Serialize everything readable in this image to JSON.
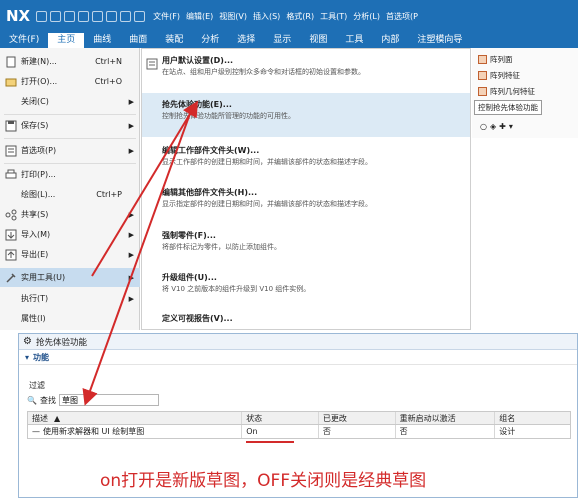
{
  "titlebar": {
    "logo": "NX",
    "menus": [
      "文件(F)",
      "编辑(E)",
      "视图(V)",
      "插入(S)",
      "格式(R)",
      "工具(T)",
      "分析(L)",
      "首选项(P"
    ]
  },
  "ribbon_tabs": [
    "文件(F)",
    "主页",
    "曲线",
    "曲面",
    "装配",
    "分析",
    "选择",
    "显示",
    "视图",
    "工具",
    "内部",
    "注塑模向导"
  ],
  "file_menu": [
    {
      "label": "新建(N)...",
      "shortcut": "Ctrl+N",
      "submenu": false
    },
    {
      "label": "打开(O)...",
      "shortcut": "Ctrl+O",
      "submenu": false
    },
    {
      "label": "关闭(C)",
      "shortcut": "",
      "submenu": true
    },
    {
      "label": "保存(S)",
      "shortcut": "",
      "submenu": true
    },
    {
      "label": "首选项(P)",
      "shortcut": "",
      "submenu": true
    },
    {
      "label": "打印(P)...",
      "shortcut": "",
      "submenu": false
    },
    {
      "label": "绘图(L)...",
      "shortcut": "Ctrl+P",
      "submenu": false
    },
    {
      "label": "共享(S)",
      "shortcut": "",
      "submenu": true
    },
    {
      "label": "导入(M)",
      "shortcut": "",
      "submenu": true
    },
    {
      "label": "导出(E)",
      "shortcut": "",
      "submenu": true
    },
    {
      "label": "实用工具(U)",
      "shortcut": "",
      "submenu": true
    },
    {
      "label": "执行(T)",
      "shortcut": "",
      "submenu": true
    },
    {
      "label": "属性(I)",
      "shortcut": "",
      "submenu": false
    }
  ],
  "submenu": [
    {
      "title": "用户默认设置(D)...",
      "desc": "在站点、组和用户级别控制众多命令和对话框的初始设置和参数。"
    },
    {
      "title": "抢先体验功能(E)...",
      "desc": "控制抢先体验功能所管理的功能的可用性。"
    },
    {
      "title": "编辑工作部件文件头(W)...",
      "desc": "显示工作部件的创建日期和时间，并编辑该部件的状态和描述字段。"
    },
    {
      "title": "编辑其他部件文件头(H)...",
      "desc": "显示指定部件的创建日期和时间，并编辑该部件的状态和描述字段。"
    },
    {
      "title": "强制零件(F)...",
      "desc": "将部件标记为零件，以防止添加组件。"
    },
    {
      "title": "升级组件(U)...",
      "desc": "将 V10 之前版本的组件升级到 V10 组件实例。"
    },
    {
      "title": "定义可视报告(V)...",
      "desc": ""
    }
  ],
  "right_panel": {
    "items": [
      "阵列面",
      "阵列特征",
      "阵列几何特征"
    ],
    "tooltip": "控制抢先体验功能"
  },
  "dialog": {
    "title": "抢先体验功能",
    "section": "功能",
    "filter_label": "过滤",
    "find_label": "查找",
    "search_value": "草图",
    "columns": [
      "描述",
      "状态",
      "已更改",
      "重新启动以激活",
      "组名"
    ],
    "rows": [
      {
        "desc": "使用新求解器和 UI 绘制草图",
        "status": "On",
        "changed": "否",
        "restart": "否",
        "group": "设计"
      }
    ]
  },
  "annotation": "on打开是新版草图，OFF关闭则是经典草图",
  "colors": {
    "brand": "#1e6fb5",
    "highlight": "#c7dcef",
    "annotation": "#d32a2a"
  }
}
